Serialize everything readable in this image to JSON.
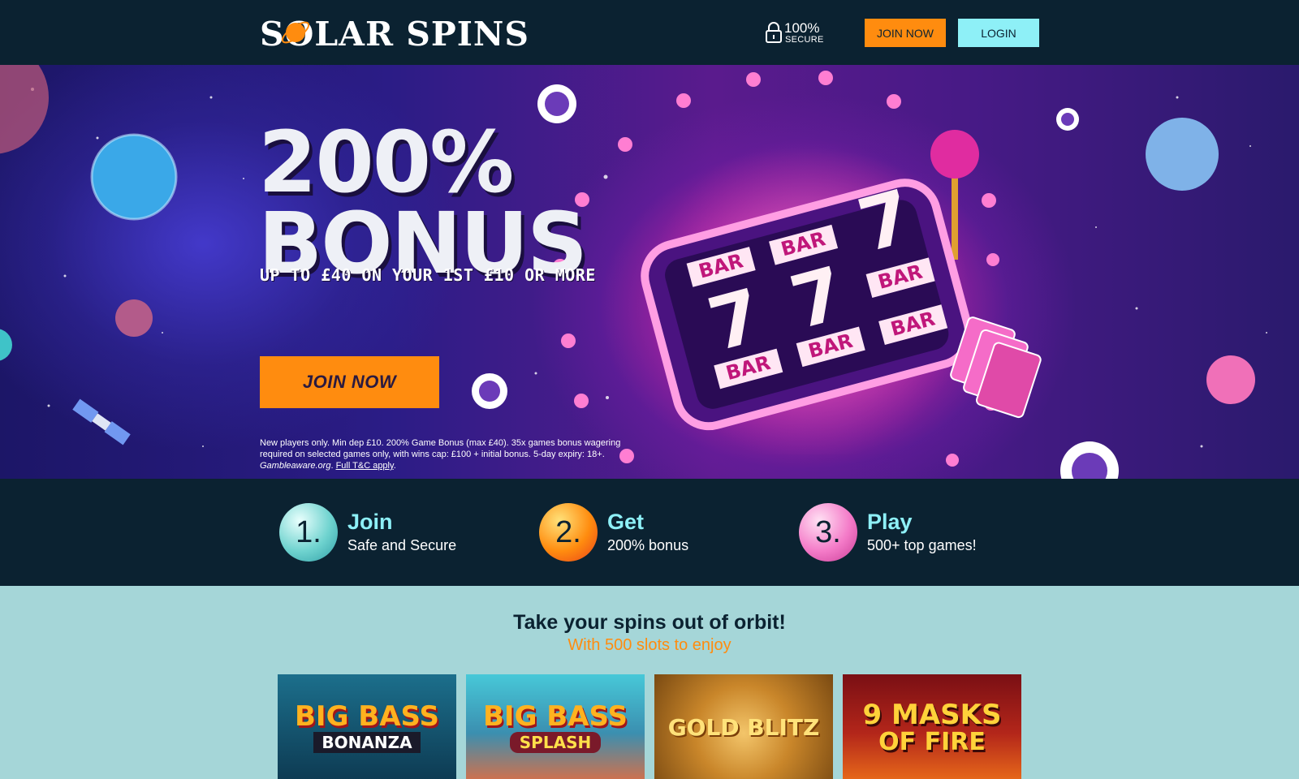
{
  "header": {
    "logo_text": "SOLAR SPINS",
    "secure_percent": "100%",
    "secure_label": "SECURE",
    "join_label": "JOIN NOW",
    "login_label": "LOGIN"
  },
  "hero": {
    "headline_line1": "200%",
    "headline_line2": "BONUS",
    "subheadline": "UP TO £40 ON YOUR 1ST £10 OR MORE",
    "cta_label": "JOIN NOW",
    "terms_text": "New players only. Min dep £10. 200% Game Bonus (max £40). 35x games bonus wagering required on selected games only, with wins cap: £100 + initial bonus. 5-day expiry: 18+.",
    "terms_site": "Gambleaware.org",
    "terms_link": "Full T&C apply",
    "slot_symbols": [
      "BAR",
      "7",
      "BAR",
      "BAR",
      "7",
      "BAR",
      "7",
      "BAR",
      "BAR"
    ]
  },
  "steps": [
    {
      "number": "1.",
      "title": "Join",
      "desc": "Safe and Secure",
      "color": "#6fd3cf"
    },
    {
      "number": "2.",
      "title": "Get",
      "desc": "200% bonus",
      "color": "#ff8c0f"
    },
    {
      "number": "3.",
      "title": "Play",
      "desc": "500+ top games!",
      "color": "#f47bc8"
    }
  ],
  "games": {
    "title": "Take your spins out of orbit!",
    "subtitle": "With 500 slots to enjoy",
    "tiles": [
      {
        "line1": "BIG BASS",
        "line2": "BONANZA"
      },
      {
        "line1": "BIG BASS",
        "line2": "SPLASH"
      },
      {
        "line1": "GOLD BLITZ",
        "line2": ""
      },
      {
        "line1": "9 MASKS",
        "line2": "OF FIRE"
      }
    ]
  },
  "colors": {
    "background": "#0b2231",
    "accent_orange": "#ff8c0f",
    "accent_cyan": "#8ef0f7",
    "games_bg": "#a5d6d8"
  }
}
